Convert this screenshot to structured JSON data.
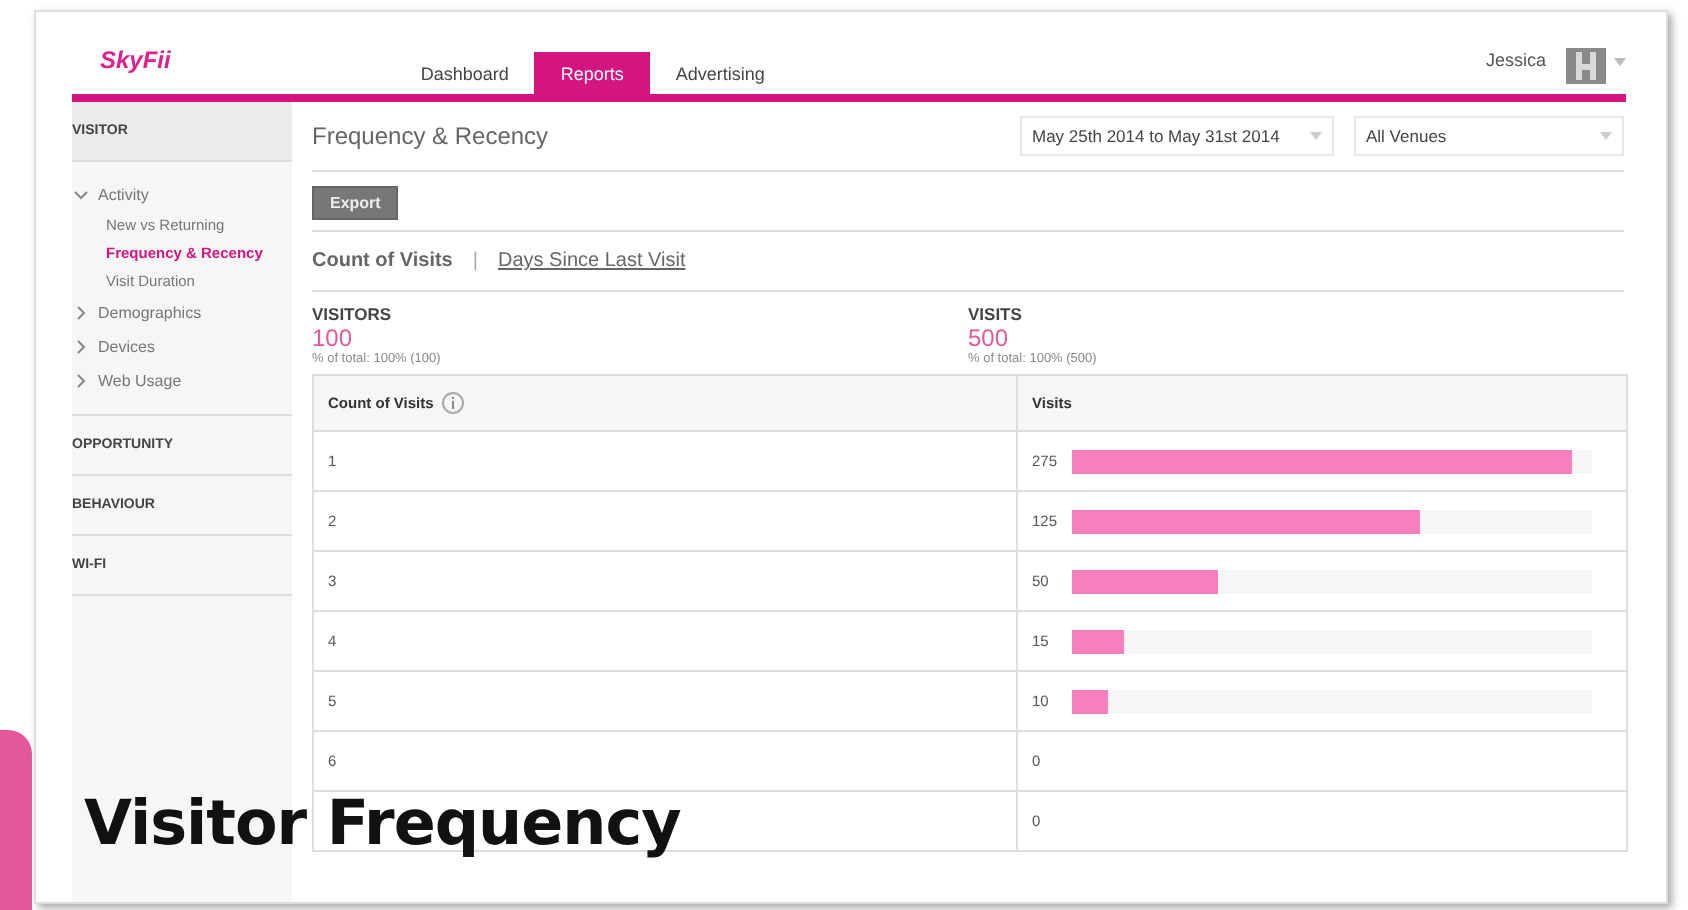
{
  "header": {
    "logo": "SkyFii",
    "tabs": [
      {
        "label": "Dashboard",
        "selected": false
      },
      {
        "label": "Reports",
        "selected": true
      },
      {
        "label": "Advertising",
        "selected": false
      }
    ],
    "user": "Jessica"
  },
  "sidebar": {
    "sections": [
      {
        "label": "VISITOR",
        "items": [
          {
            "label": "Activity",
            "expanded": true,
            "children": [
              {
                "label": "New vs Returning",
                "selected": false
              },
              {
                "label": "Frequency & Recency",
                "selected": true
              },
              {
                "label": "Visit Duration",
                "selected": false
              }
            ]
          },
          {
            "label": "Demographics",
            "expanded": false
          },
          {
            "label": "Devices",
            "expanded": false
          },
          {
            "label": "Web Usage",
            "expanded": false
          }
        ]
      },
      {
        "label": "OPPORTUNITY"
      },
      {
        "label": "BEHAVIOUR"
      },
      {
        "label": "WI-FI"
      }
    ]
  },
  "main": {
    "title": "Frequency & Recency",
    "date_range": "May 25th 2014 to May 31st 2014",
    "venue": "All Venues",
    "export": "Export",
    "subtabs": [
      {
        "label": "Count of Visits",
        "selected": true
      },
      {
        "label": "Days Since Last Visit",
        "selected": false
      }
    ],
    "separator": "|",
    "stats": [
      {
        "label": "VISITORS",
        "value": "100",
        "note": "% of total: 100% (100)"
      },
      {
        "label": "VISITS",
        "value": "500",
        "note": "% of total: 100% (500)"
      }
    ],
    "table": {
      "columns": [
        "Count of Visits",
        "Visits"
      ],
      "rows": [
        {
          "count": "1",
          "visits": "275",
          "level": 0.96
        },
        {
          "count": "2",
          "visits": "125",
          "level": 0.67
        },
        {
          "count": "3",
          "visits": "50",
          "level": 0.28
        },
        {
          "count": "4",
          "visits": "15",
          "level": 0.1
        },
        {
          "count": "5",
          "visits": "10",
          "level": 0.07
        },
        {
          "count": "6",
          "visits": "0"
        },
        {
          "visits": "0"
        }
      ]
    }
  },
  "caption": "Visitor Frequency"
}
